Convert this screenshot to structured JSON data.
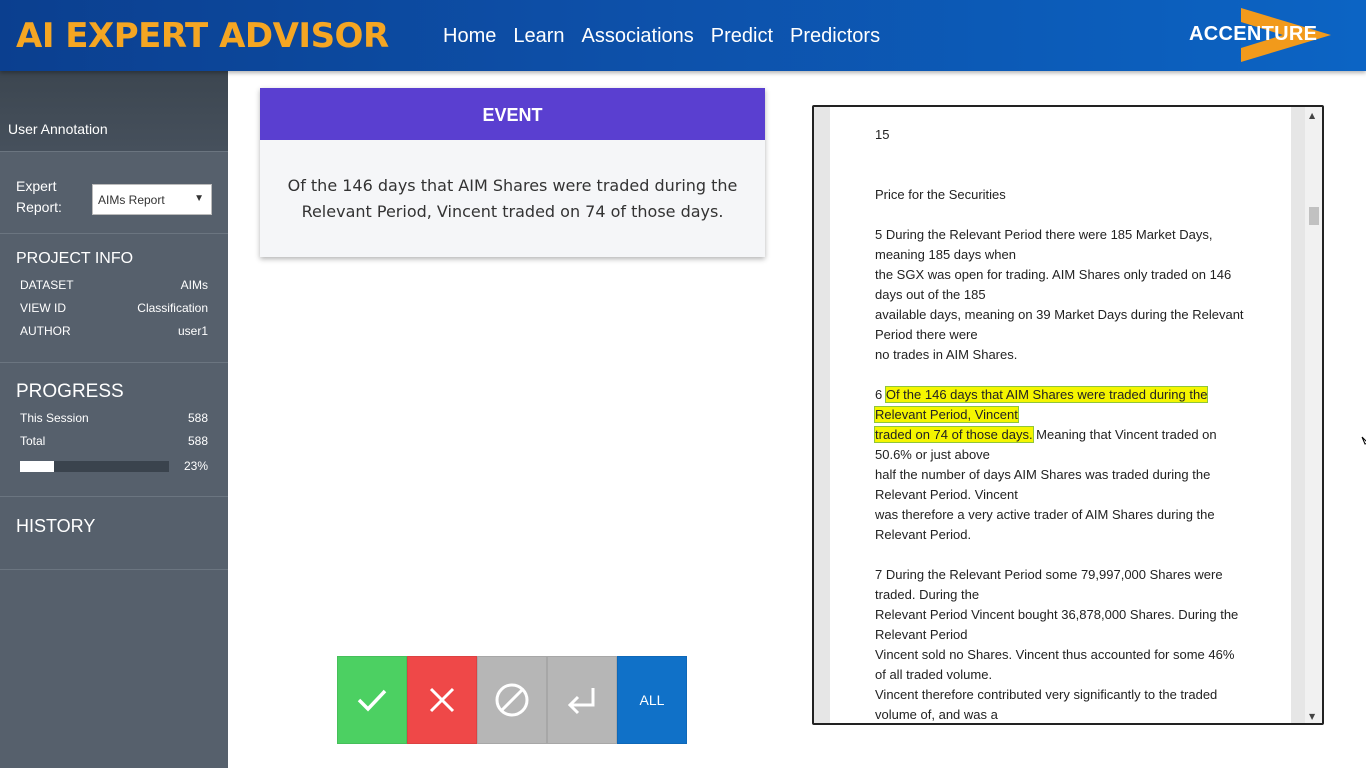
{
  "header": {
    "brand": "AI EXPERT ADVISOR",
    "nav": [
      "Home",
      "Learn",
      "Associations",
      "Predict",
      "Predictors"
    ],
    "logo": "ACCENTURE",
    "colors": {
      "brand": "#f5a623",
      "bar": "#0d4ea6",
      "logo_arrow": "#f29a1b"
    }
  },
  "sidebar": {
    "title": "User Annotation",
    "expert_report_label": "Expert Report:",
    "expert_report_value": "AIMs Report",
    "project_info": {
      "heading": "PROJECT INFO",
      "rows": [
        {
          "key": "DATASET",
          "value": "AIMs"
        },
        {
          "key": "VIEW ID",
          "value": "Classification"
        },
        {
          "key": "AUTHOR",
          "value": "user1"
        }
      ]
    },
    "progress": {
      "heading": "PROGRESS",
      "rows": [
        {
          "key": "This Session",
          "value": "588"
        },
        {
          "key": "Total",
          "value": "588"
        }
      ],
      "percent_label": "23%",
      "fraction": 0.23
    },
    "history_heading": "HISTORY"
  },
  "event": {
    "heading": "EVENT",
    "text": "Of the 146 days that AIM Shares were traded during the Relevant Period, Vincent traded on 74 of those days.",
    "header_color": "#5a3fd0"
  },
  "actions": {
    "icons": [
      "check-icon",
      "x-icon",
      "ban-icon",
      "return-icon"
    ],
    "all_label": "ALL",
    "colors": {
      "accept": "#4cd062",
      "reject": "#ef4848",
      "skip": "#b6b6b6",
      "all": "#1071c8"
    }
  },
  "document": {
    "page_number": "15",
    "heading": "Price for the Securities",
    "para5": [
      "5 During the Relevant Period there were 185 Market Days,",
      "meaning 185 days when",
      "the SGX was open for trading.  AIM Shares only traded on 146",
      "days out of the 185",
      "available days, meaning on 39 Market Days during the Relevant",
      "Period there were",
      "no trades in AIM Shares."
    ],
    "para6_prefix": "6 ",
    "para6_highlight": [
      "Of the 146 days that AIM Shares were traded during the",
      "Relevant Period, Vincent",
      "traded on 74 of those days."
    ],
    "para6_rest_first": " Meaning that Vincent traded on",
    "para6_rest": [
      "50.6% or just above",
      "half the number of days AIM Shares was traded during the",
      "Relevant Period.  Vincent",
      "was therefore a very active trader of AIM Shares during the",
      "Relevant Period."
    ],
    "para7": [
      "7 During the Relevant Period some 79,997,000 Shares were",
      "traded.  During the",
      "Relevant Period Vincent bought 36,878,000 Shares.  During the",
      "Relevant Period",
      "Vincent sold no Shares.  Vincent thus accounted for some 46%",
      "of all traded volume.",
      "Vincent therefore contributed very significantly to the traded",
      "volume of, and was a"
    ],
    "highlight_color": "#f5f500"
  }
}
